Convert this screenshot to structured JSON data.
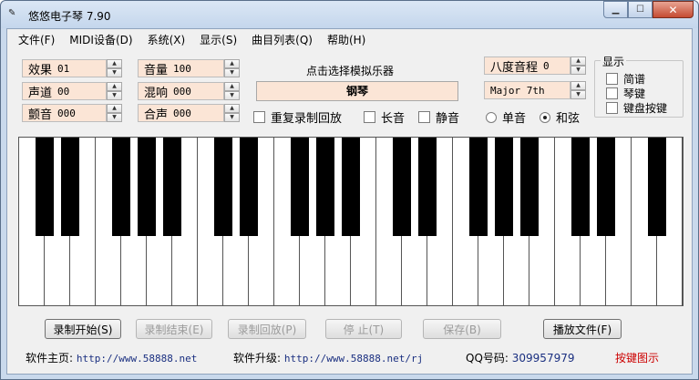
{
  "window": {
    "title": "悠悠电子琴 7.90",
    "app_icon_text": "✎"
  },
  "menu": [
    "文件(F)",
    "MIDI设备(D)",
    "系统(X)",
    "显示(S)",
    "曲目列表(Q)",
    "帮助(H)"
  ],
  "spins": {
    "effect": {
      "label": "效果",
      "value": "01"
    },
    "channel": {
      "label": "声道",
      "value": "00"
    },
    "tremolo": {
      "label": "颤音",
      "value": "000"
    },
    "volume": {
      "label": "音量",
      "value": "100"
    },
    "reverb": {
      "label": "混响",
      "value": "000"
    },
    "chorus": {
      "label": "合声",
      "value": "000"
    },
    "octave": {
      "label": "八度音程",
      "value": "0"
    },
    "chord_type": {
      "label": "",
      "value": "Major 7th"
    }
  },
  "instrument": {
    "prompt": "点击选择模拟乐器",
    "current": "钢琴"
  },
  "options": {
    "repeat_record": "重复录制回放",
    "sustain": "长音",
    "mute": "静音",
    "single_note": "单音",
    "chord": "和弦"
  },
  "display_group": {
    "title": "显示",
    "items": [
      "简谱",
      "琴键",
      "键盘按键"
    ]
  },
  "buttons": {
    "record_start": "录制开始(S)",
    "record_end": "录制结束(E)",
    "record_play": "录制回放(P)",
    "stop": "停 止(T)",
    "save": "保存(B)",
    "play_file": "播放文件(F)"
  },
  "footer": {
    "home_label": "软件主页:",
    "home_url": "http://www.58888.net",
    "update_label": "软件升级:",
    "update_url": "http://www.58888.net/rj",
    "qq_label": "QQ号码:",
    "qq_value": "309957979",
    "key_map": "按键图示"
  },
  "colors": {
    "field_bg": "#fbe5d6",
    "link": "#1a2f80",
    "key_map": "#cc0000"
  }
}
